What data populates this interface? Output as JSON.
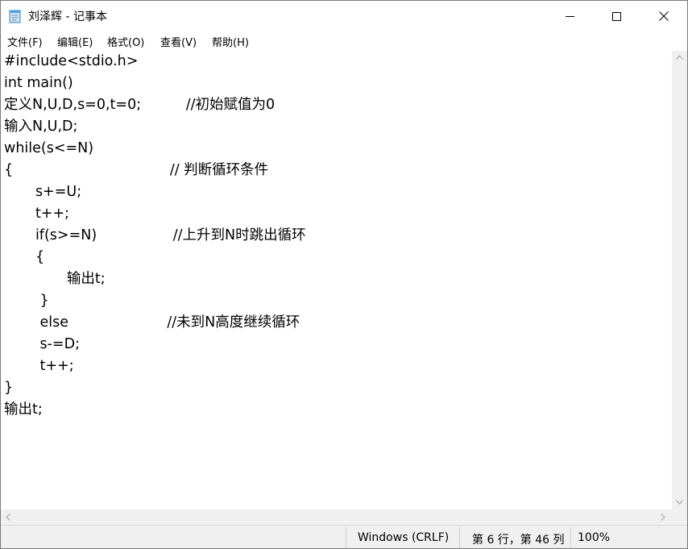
{
  "window": {
    "title": "刘泽辉 - 记事本",
    "icon": "notepad-icon"
  },
  "controls": {
    "minimize": "minimize-icon",
    "maximize": "maximize-icon",
    "close": "close-icon"
  },
  "menu": {
    "items": [
      {
        "label": "文件(F)"
      },
      {
        "label": "编辑(E)"
      },
      {
        "label": "格式(O)"
      },
      {
        "label": "查看(V)"
      },
      {
        "label": "帮助(H)"
      }
    ]
  },
  "editor": {
    "lines": [
      "#include<stdio.h>",
      "int main()",
      "定义N,U,D,s=0,t=0;          //初始赋值为0",
      "输入N,U,D;",
      "while(s<=N)",
      "{                                   // 判断循环条件",
      "       s+=U;",
      "       t++;",
      "       if(s>=N)                 //上升到N时跳出循环",
      "       {",
      "              输出t;",
      "        }",
      "        else                      //未到N高度继续循环",
      "        s-=D;",
      "        t++;",
      "}",
      "输出t;"
    ]
  },
  "status": {
    "encoding": "Windows (CRLF)",
    "position": "第 6 行，第 46 列",
    "zoom": "100%"
  }
}
